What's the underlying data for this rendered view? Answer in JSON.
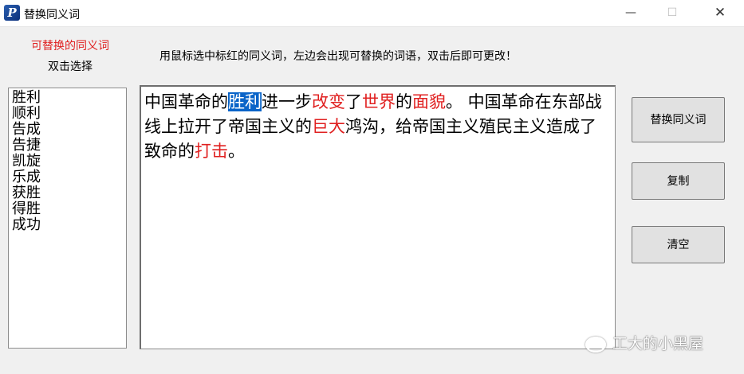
{
  "window": {
    "title": "替换同义词",
    "app_icon": "P"
  },
  "controls": {
    "minimize": "—",
    "maximize": "☐",
    "close": "✕"
  },
  "left_panel": {
    "label_red": "可替换的同义词",
    "label_black": "双击选择",
    "items": [
      "胜利",
      "顺利",
      "告成",
      "告捷",
      "凯旋",
      "乐成",
      "获胜",
      "得胜",
      "成功"
    ]
  },
  "instruction": "用鼠标选中标红的同义词，左边会出现可替换的词语，双击后即可更改！",
  "editor": {
    "segments": [
      {
        "text": "中国革命的",
        "style": "normal"
      },
      {
        "text": "胜利",
        "style": "selected"
      },
      {
        "text": "进一步",
        "style": "normal"
      },
      {
        "text": "改变",
        "style": "red"
      },
      {
        "text": "了",
        "style": "normal"
      },
      {
        "text": "世界",
        "style": "red"
      },
      {
        "text": "的",
        "style": "normal"
      },
      {
        "text": "面貌",
        "style": "red"
      },
      {
        "text": "。  中国革命在东部战线上拉开了帝国主义的",
        "style": "normal"
      },
      {
        "text": "巨大",
        "style": "red"
      },
      {
        "text": "鸿沟，给帝国主义殖民主义造成了致命的",
        "style": "normal"
      },
      {
        "text": "打击",
        "style": "red"
      },
      {
        "text": "。",
        "style": "normal"
      }
    ]
  },
  "buttons": {
    "replace": "替换同义词",
    "copy": "复制",
    "clear": "清空"
  },
  "watermark": "工大的小黑屋",
  "colors": {
    "accent_red": "#e02020",
    "selection": "#0a64c8"
  }
}
